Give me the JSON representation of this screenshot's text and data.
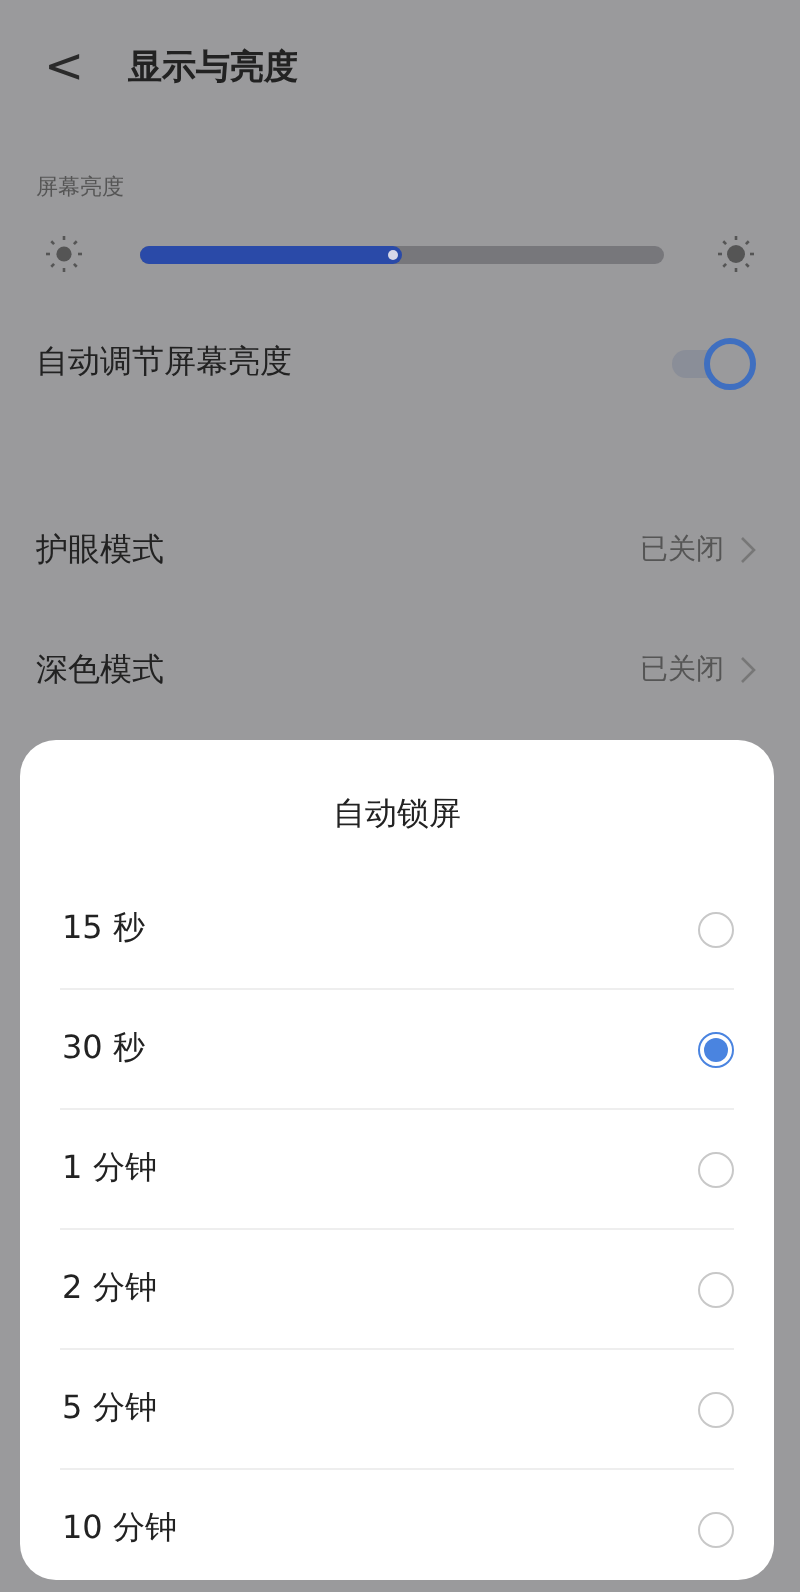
{
  "header": {
    "back": "<",
    "title": "显示与亮度"
  },
  "brightness": {
    "label": "屏幕亮度",
    "level": 0.5
  },
  "auto_brightness": {
    "label": "自动调节屏幕亮度",
    "on": true
  },
  "settings": [
    {
      "label": "护眼模式",
      "value": "已关闭"
    },
    {
      "label": "深色模式",
      "value": "已关闭"
    }
  ],
  "sheet": {
    "title": "自动锁屏",
    "options": [
      {
        "label": "15 秒",
        "selected": false
      },
      {
        "label": "30 秒",
        "selected": true
      },
      {
        "label": "1 分钟",
        "selected": false
      },
      {
        "label": "2 分钟",
        "selected": false
      },
      {
        "label": "5 分钟",
        "selected": false
      },
      {
        "label": "10 分钟",
        "selected": false
      }
    ]
  }
}
